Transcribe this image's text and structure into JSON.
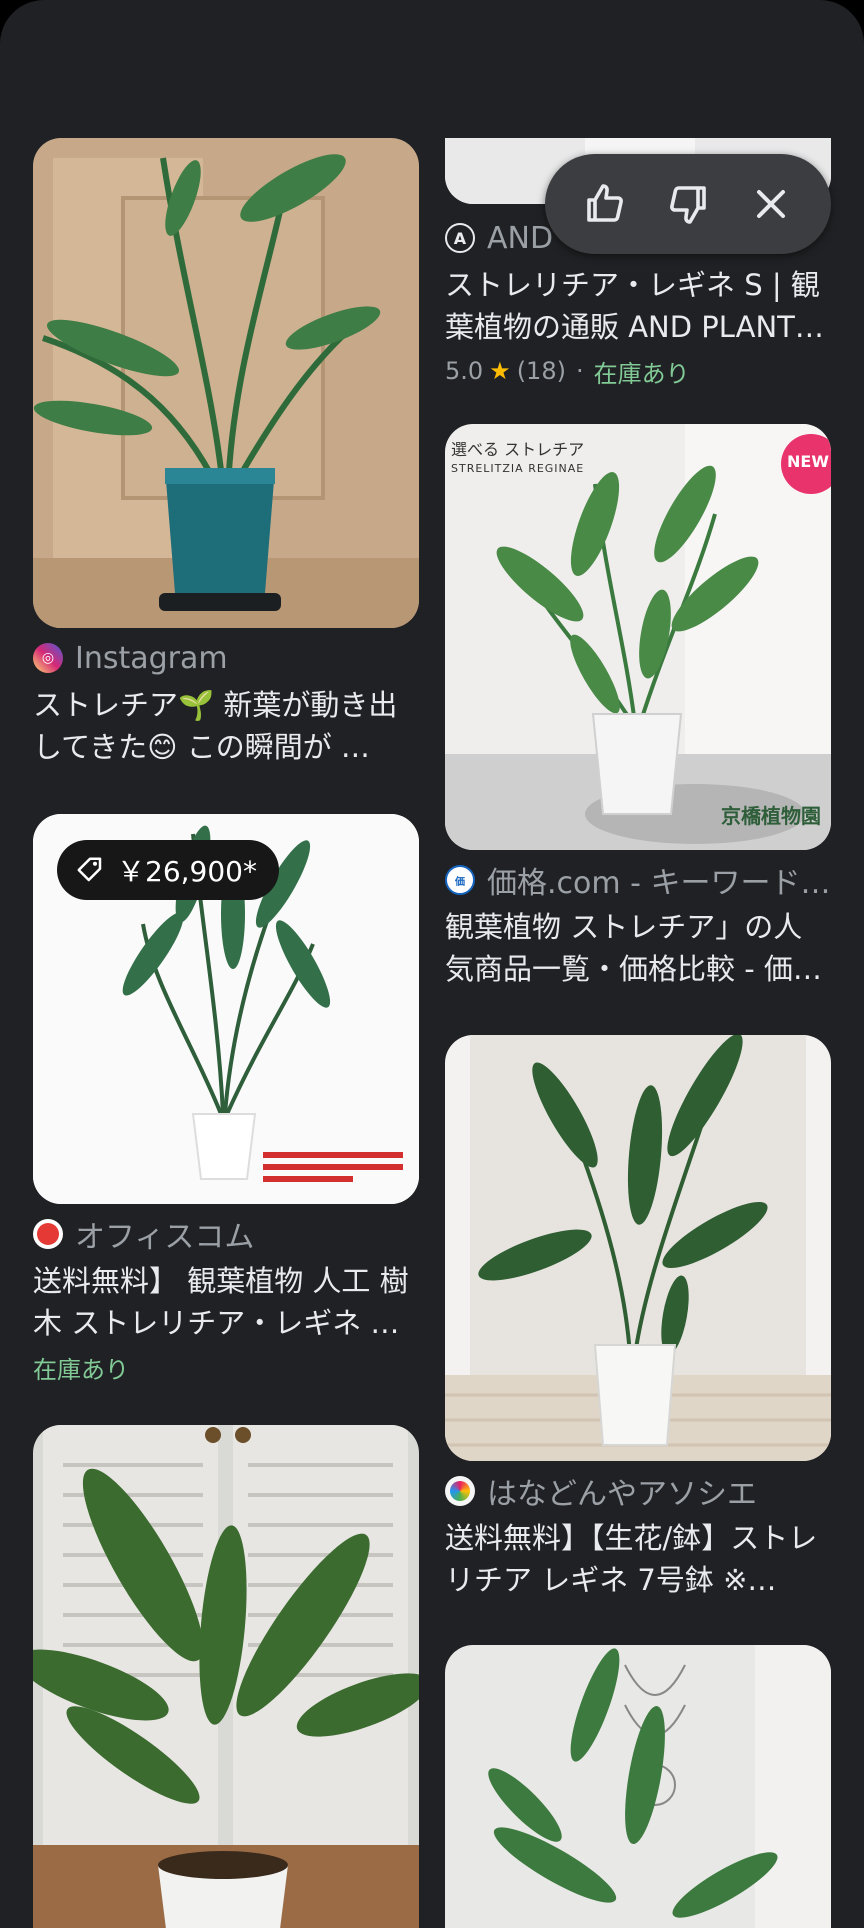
{
  "feedback_bar": {
    "like_icon": "thumb-up-icon",
    "dislike_icon": "thumb-down-icon",
    "close_icon": "close-icon"
  },
  "left_column": [
    {
      "source": "Instagram",
      "favicon_color": "#d62976",
      "title": "ストレチア🌱 新葉が動き出してきた😊 この瞬間が …"
    },
    {
      "price": "￥26,900*",
      "source": "オフィスコム",
      "favicon_color": "#e53935",
      "title": "送料無料】 観葉植物 人工 樹木 ストレリチア・レギネ …",
      "stock": "在庫あり"
    },
    {
      "source": "",
      "title": ""
    }
  ],
  "right_column": [
    {
      "source": "AND",
      "favicon_color": "#e8eaed",
      "title": "ストレリチア・レギネ S | 観葉植物の通販 AND PLANT…",
      "rating": "5.0",
      "reviews": "(18)",
      "stock": "在庫あり"
    },
    {
      "image_text_top": "選べる ストレチア",
      "image_text_sub": "STRELITZIA REGINAE",
      "image_badge": "NEW",
      "image_watermark": "京橋植物園",
      "source": "価格.com - キーワード…",
      "favicon_color": "#1565c0",
      "title": "観葉植物 ストレチア」の人気商品一覧・価格比較 - 価…"
    },
    {
      "source": "はなどんやアソシエ",
      "favicon_color": "#f5f5f5",
      "title": "送料無料】【生花/鉢】ストレリチア レギネ 7号鉢 ※…"
    }
  ],
  "colors": {
    "background": "#202124",
    "stock_green": "#81c995",
    "star": "#fbbc04"
  }
}
